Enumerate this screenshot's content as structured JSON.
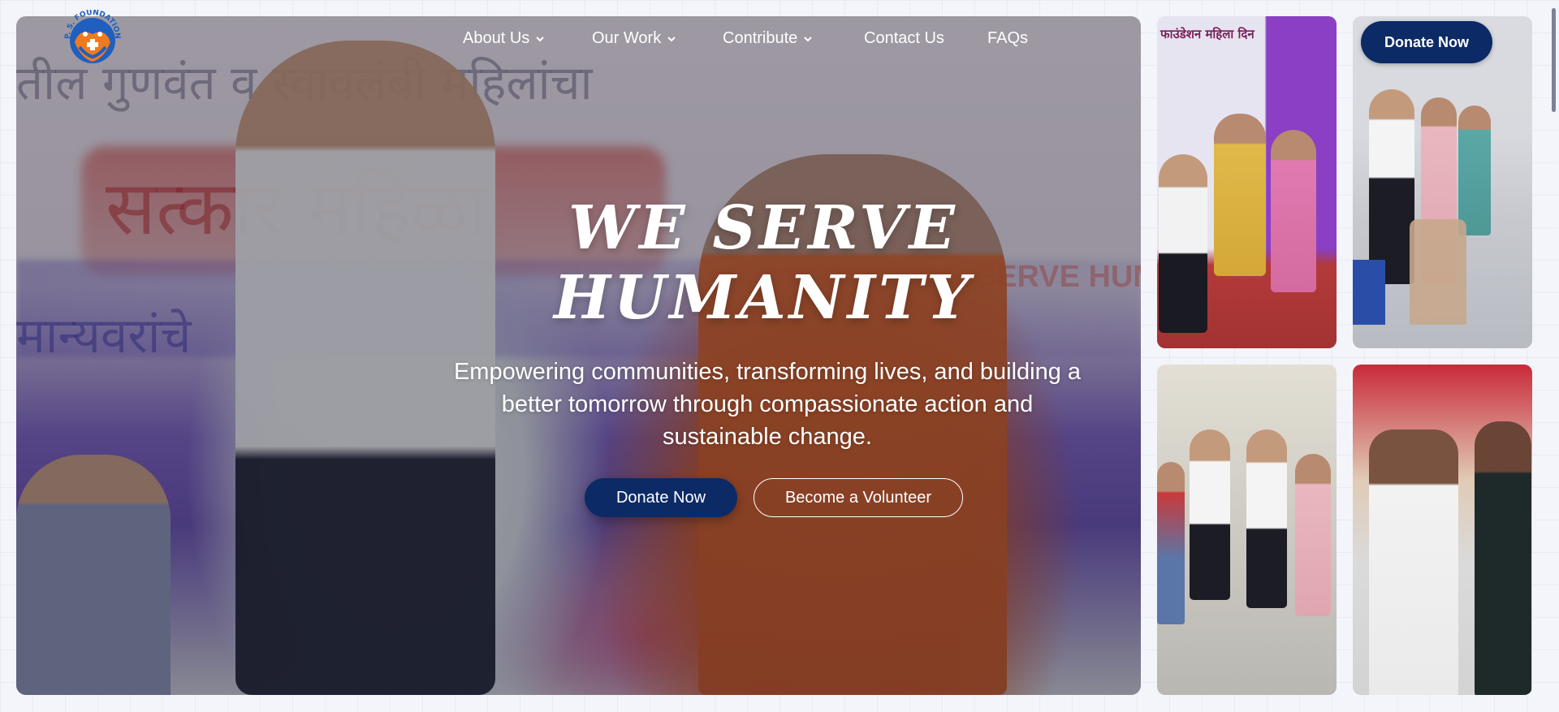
{
  "brand": {
    "logo_text": "P. S. FOUNDATION",
    "colors": {
      "primary": "#0c2a66",
      "accent": "#f07a1e",
      "logo_blue": "#1f5fbf"
    }
  },
  "nav": {
    "items": [
      {
        "label": "About Us",
        "has_dropdown": true
      },
      {
        "label": "Our Work",
        "has_dropdown": true
      },
      {
        "label": "Contribute",
        "has_dropdown": true
      },
      {
        "label": "Contact Us",
        "has_dropdown": false
      },
      {
        "label": "FAQs",
        "has_dropdown": false
      }
    ],
    "donate_label": "Donate Now"
  },
  "hero": {
    "title_line1": "We Serve",
    "title_line2": "Humanity",
    "subtitle": "Empowering communities, transforming lives, and building a better tomorrow through compassionate action and sustainable change.",
    "primary_button": "Donate Now",
    "secondary_button": "Become a Volunteer",
    "background_text": {
      "line1": "तील गुणवंत व स्वावलंबी महिलांचा",
      "line2": "सत्कार महिळा",
      "line3": "मान्यवरांचे",
      "line4": "WE SERVE HUM"
    }
  },
  "gallery": {
    "tiles": [
      {
        "caption_text": "फाउंडेशन महिला दिन"
      },
      {
        "caption_text": ""
      },
      {
        "caption_text": ""
      },
      {
        "caption_text": ""
      }
    ]
  }
}
